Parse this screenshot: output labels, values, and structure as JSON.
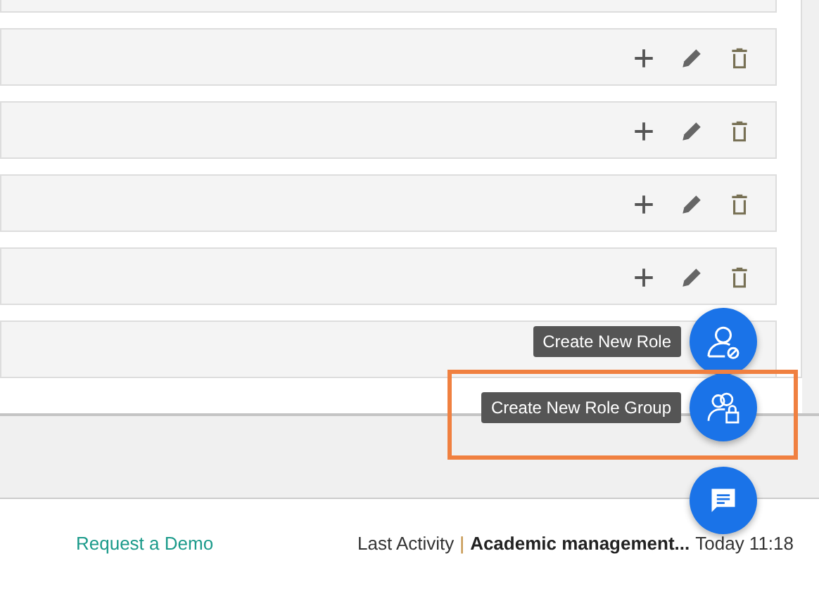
{
  "role_rows": [
    {
      "kind": "blank"
    },
    {
      "kind": "actions"
    },
    {
      "kind": "actions"
    },
    {
      "kind": "actions"
    },
    {
      "kind": "actions"
    },
    {
      "kind": "blank"
    }
  ],
  "fab_menu": [
    {
      "kind": "role",
      "tooltip": "Create New Role",
      "highlighted": false
    },
    {
      "kind": "group",
      "tooltip": "Create New Role Group",
      "highlighted": true
    }
  ],
  "chat": {
    "kind": "chat"
  },
  "footer": {
    "link": "Request a Demo",
    "label": "Last Activity",
    "separator": "|",
    "item": "Academic management...",
    "time": "Today 11:18"
  }
}
